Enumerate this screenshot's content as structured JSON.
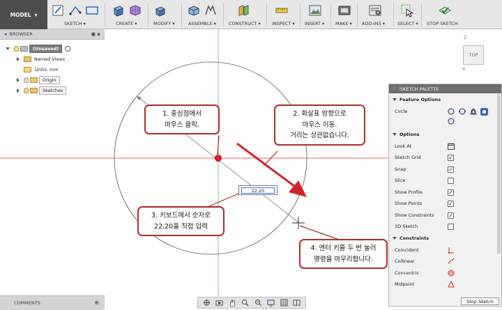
{
  "toolbar": {
    "model_label": "MODEL",
    "groups": [
      {
        "label": "SKETCH"
      },
      {
        "label": "CREATE"
      },
      {
        "label": "MODIFY"
      },
      {
        "label": "ASSEMBLE"
      },
      {
        "label": "CONSTRUCT"
      },
      {
        "label": "INSPECT"
      },
      {
        "label": "INSERT"
      },
      {
        "label": "MAKE"
      },
      {
        "label": "ADD-INS"
      },
      {
        "label": "SELECT"
      },
      {
        "label": "STOP SKETCH"
      }
    ]
  },
  "browser": {
    "title": "BROWSER",
    "items": [
      {
        "label": "(Unsaved)"
      },
      {
        "label": "Named Views"
      },
      {
        "label": "Units: mm"
      },
      {
        "label": "Origin"
      },
      {
        "label": "Sketches"
      }
    ]
  },
  "canvas": {
    "dimension_value": "22.20",
    "callouts": [
      {
        "lines": [
          "1. 중심점에서",
          "마우스 클릭."
        ]
      },
      {
        "lines": [
          "2. 화살표 방향으로",
          "마우스 이동.",
          "거리는 상관없습니다."
        ]
      },
      {
        "lines": [
          "3. 키보드에서 숫자로",
          "22.20을 직접 입력"
        ]
      },
      {
        "lines": [
          "4. 엔터 키를 두 번 눌러",
          "명령을 마무리합니다."
        ]
      }
    ]
  },
  "viewcube": {
    "face_label": "TOP",
    "axis_z": "Z",
    "axis_x": "X"
  },
  "sketch_palette": {
    "title": "SKETCH PALETTE",
    "feature_options_label": "Feature Options",
    "circle_label": "Circle",
    "options_label": "Options",
    "options": [
      {
        "label": "Look At",
        "checked": null
      },
      {
        "label": "Sketch Grid",
        "checked": true
      },
      {
        "label": "Snap",
        "checked": true
      },
      {
        "label": "Slice",
        "checked": false
      },
      {
        "label": "Show Profile",
        "checked": true
      },
      {
        "label": "Show Points",
        "checked": true
      },
      {
        "label": "Show Constraints",
        "checked": true
      },
      {
        "label": "3D Sketch",
        "checked": false
      }
    ],
    "constraints_label": "Constraints",
    "constraints": [
      {
        "label": "Coincident"
      },
      {
        "label": "Collinear"
      },
      {
        "label": "Concentric"
      },
      {
        "label": "Midpoint"
      }
    ],
    "stop_sketch_label": "Stop Sketch"
  },
  "comments": {
    "title": "COMMENTS"
  },
  "colors": {
    "callout_border": "#b12a2a",
    "arrow": "#d2232a",
    "x_axis": "#e56a6a",
    "y_axis": "#7cc47c",
    "model_button": "#4d4d4d"
  }
}
